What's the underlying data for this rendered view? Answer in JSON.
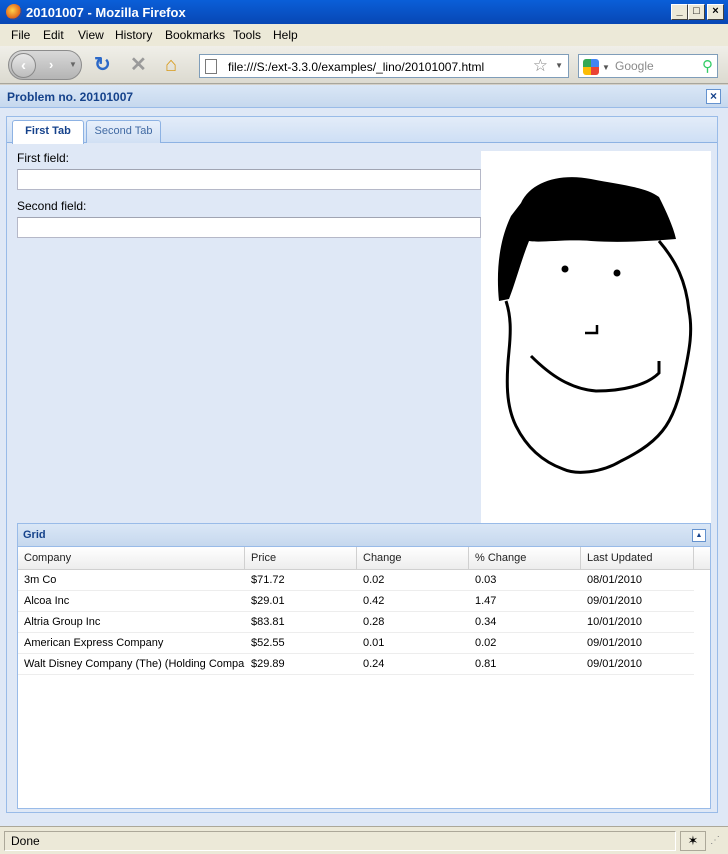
{
  "window": {
    "title": "20101007 - Mozilla Firefox",
    "minimize": "_",
    "maximize": "□",
    "close": "×"
  },
  "menu": [
    "File",
    "Edit",
    "View",
    "History",
    "Bookmarks",
    "Tools",
    "Help"
  ],
  "toolbar": {
    "url": "file:///S:/ext-3.3.0/examples/_lino/20101007.html",
    "search_placeholder": "Google"
  },
  "panel": {
    "title": "Problem no. 20101007",
    "close_glyph": "×"
  },
  "tabs": [
    {
      "label": "First Tab",
      "active": true
    },
    {
      "label": "Second Tab",
      "active": false
    }
  ],
  "form": {
    "first_label": "First field:",
    "first_value": "",
    "second_label": "Second field:",
    "second_value": ""
  },
  "grid": {
    "title": "Grid",
    "columns": [
      "Company",
      "Price",
      "Change",
      "% Change",
      "Last Updated"
    ],
    "rows": [
      [
        "3m Co",
        "$71.72",
        "0.02",
        "0.03",
        "08/01/2010"
      ],
      [
        "Alcoa Inc",
        "$29.01",
        "0.42",
        "1.47",
        "09/01/2010"
      ],
      [
        "Altria Group Inc",
        "$83.81",
        "0.28",
        "0.34",
        "10/01/2010"
      ],
      [
        "American Express Company",
        "$52.55",
        "0.01",
        "0.02",
        "09/01/2010"
      ],
      [
        "Walt Disney Company (The) (Holding Company)",
        "$29.89",
        "0.24",
        "0.81",
        "09/01/2010"
      ]
    ]
  },
  "status": {
    "text": "Done"
  },
  "colors": {
    "accent": "#15428b",
    "panel_bg": "#dfe8f6",
    "border": "#99bbe8"
  },
  "icons": [
    "firefox-icon",
    "back-icon",
    "forward-icon",
    "reload-icon",
    "stop-icon",
    "home-icon",
    "page-icon",
    "bookmark-star-icon",
    "google-icon",
    "search-icon",
    "close-icon",
    "collapse-icon",
    "bug-icon"
  ]
}
